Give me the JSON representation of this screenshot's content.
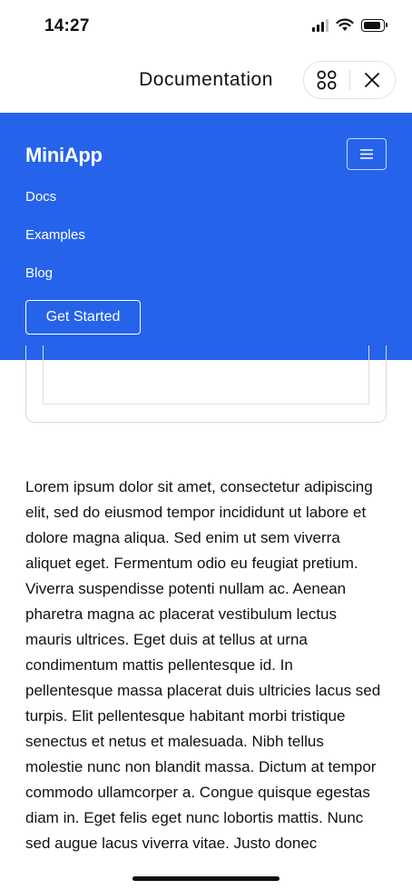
{
  "status_bar": {
    "time": "14:27",
    "signal_bars_active": 3,
    "signal_bars_total": 4,
    "battery_level": 0.85
  },
  "titlebar": {
    "title": "Documentation",
    "icons": [
      "grid-icon",
      "close-icon"
    ]
  },
  "navbar": {
    "brand": "MiniApp",
    "toggle_icon": "hamburger-icon",
    "links": [
      "Docs",
      "Examples",
      "Blog"
    ],
    "cta_label": "Get Started",
    "background": "#2563eb"
  },
  "content": {
    "paragraph": "Lorem ipsum dolor sit amet, consectetur adipiscing elit, sed do eiusmod tempor incididunt ut labore et dolore magna aliqua. Sed enim ut sem viverra aliquet eget. Fermentum odio eu feugiat pretium. Viverra suspendisse potenti nullam ac. Aenean pharetra magna ac placerat vestibulum lectus mauris ultrices. Eget duis at tellus at urna condimentum mattis pellentesque id. In pellentesque massa placerat duis ultricies lacus sed turpis. Elit pellentesque habitant morbi tristique senectus et netus et malesuada. Nibh tellus molestie nunc non blandit massa. Dictum at tempor commodo ullamcorper a. Congue quisque egestas diam in. Eget felis eget nunc lobortis mattis. Nunc sed augue lacus viverra vitae. Justo donec"
  }
}
